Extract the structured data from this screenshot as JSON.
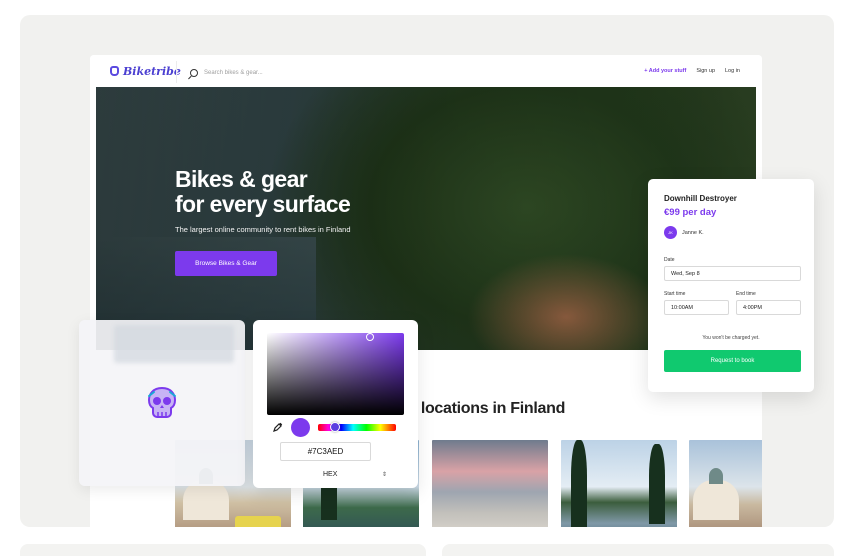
{
  "app": {
    "logo": "Biketribe",
    "search_placeholder": "Search bikes & gear...",
    "nav": {
      "add": "+ Add your stuff",
      "signup": "Sign up",
      "login": "Log in"
    }
  },
  "hero": {
    "title_line1": "Bikes & gear",
    "title_line2": "for every surface",
    "subtitle": "The largest online community to rent bikes in Finland",
    "cta": "Browse Bikes & Gear"
  },
  "section": {
    "title_visible": "ady locations in Finland"
  },
  "booking": {
    "title": "Downhill Destroyer",
    "price": "€99 per day",
    "owner_initials": "JK",
    "owner_name": "Janne K.",
    "date_label": "Date",
    "date_value": "Wed, Sep 8",
    "start_label": "Start time",
    "start_value": "10:00AM",
    "end_label": "End time",
    "end_value": "4:00PM",
    "note": "You won't be charged yet.",
    "button": "Request to book"
  },
  "color_picker": {
    "hex_value": "#7C3AED",
    "format": "HEX",
    "selected_color": "#7C3AED",
    "hue_position": 0.22
  },
  "colors": {
    "accent": "#7C3AED",
    "book_button": "#10C96F",
    "icon_color": "#7C3AED"
  },
  "icons": {
    "search": "search-icon",
    "skull": "skull-icon",
    "eyedropper": "eyedropper-icon"
  }
}
